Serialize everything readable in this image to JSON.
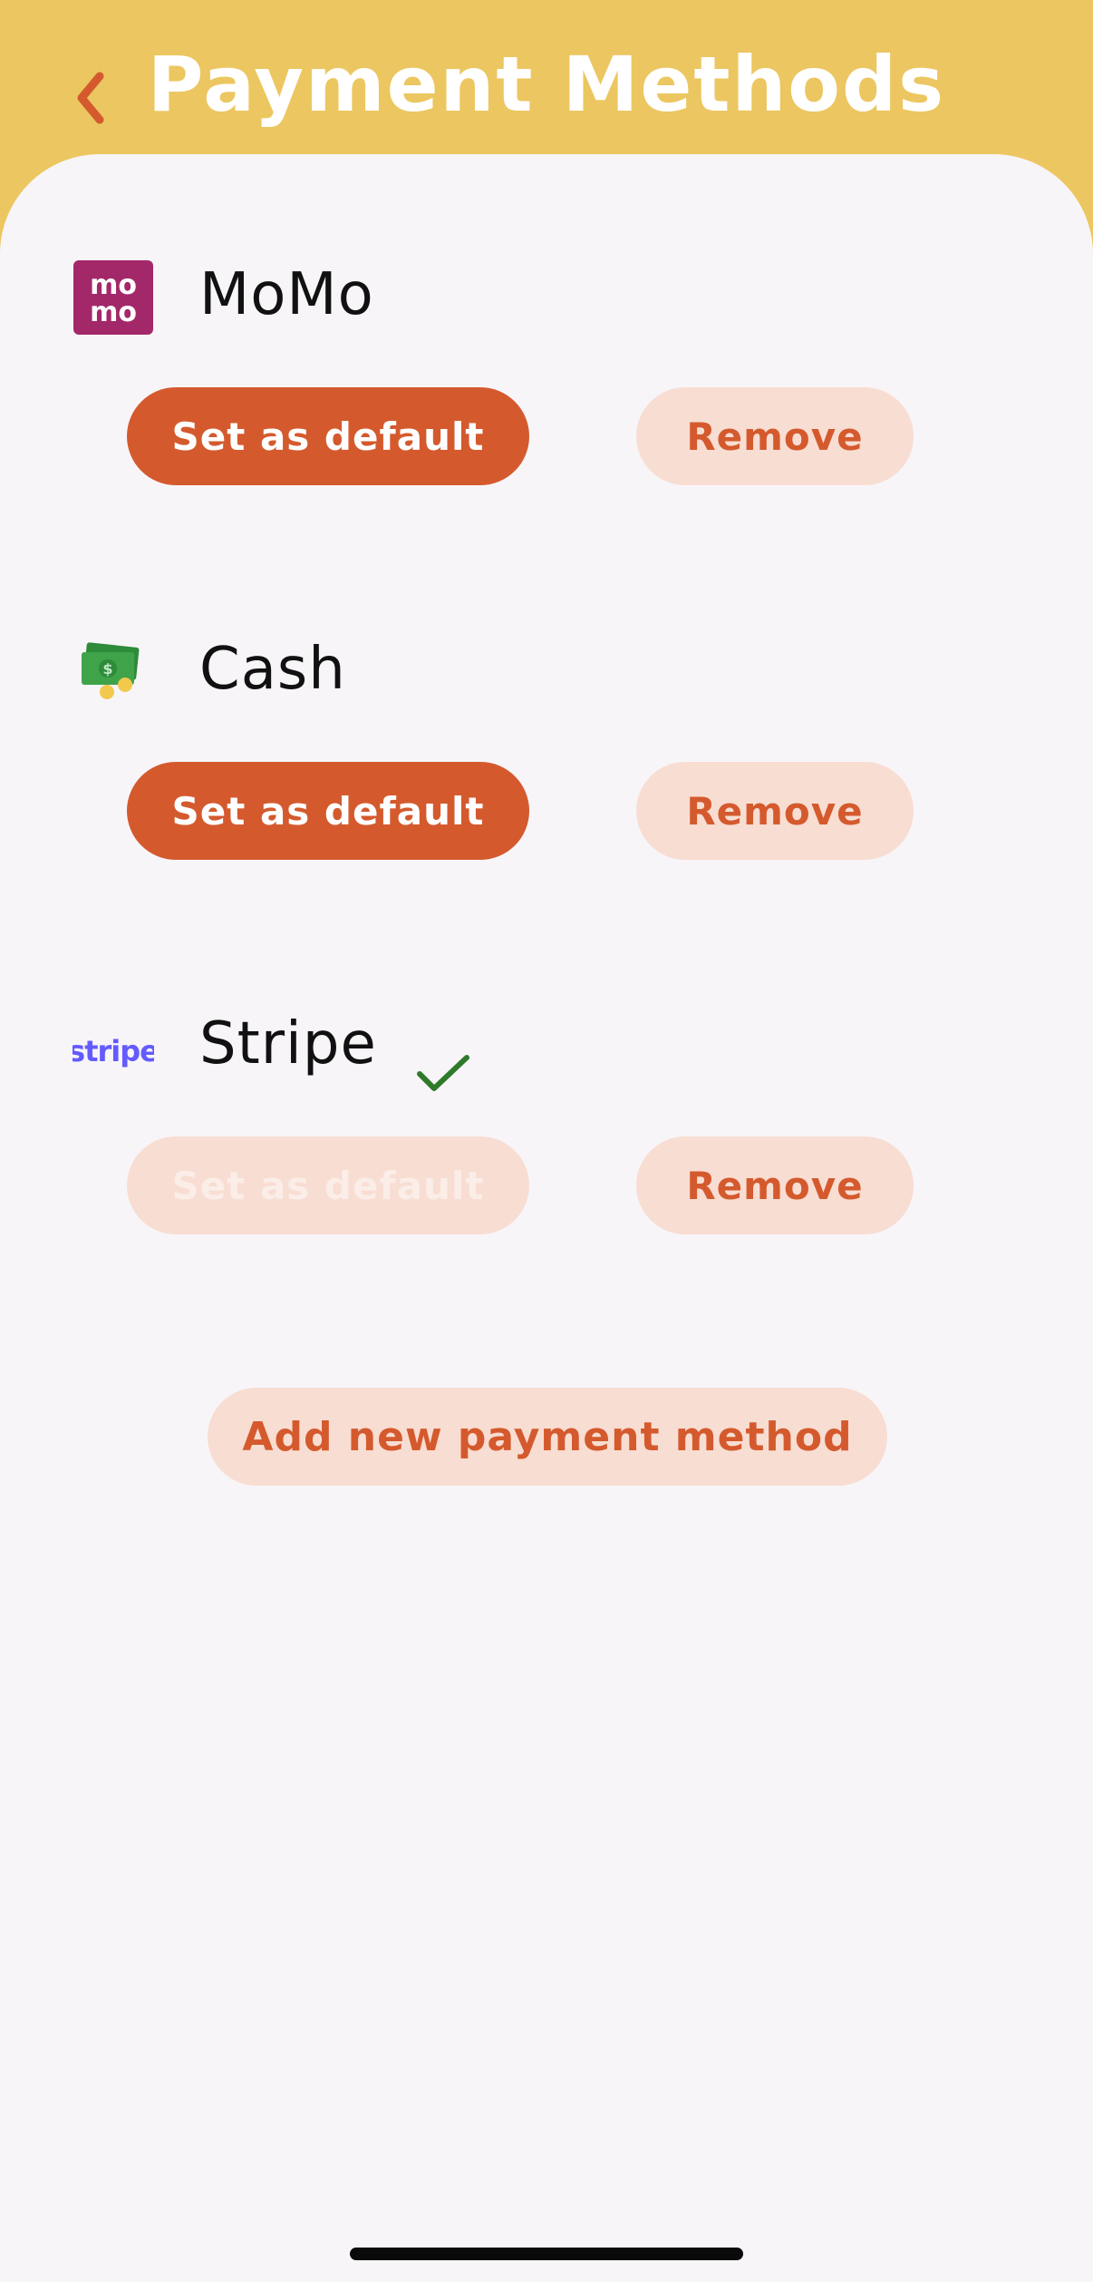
{
  "header": {
    "title": "Payment Methods",
    "back_icon": "chevron-left-icon",
    "background_color": "#ECC660",
    "accent_color": "#D45A2E"
  },
  "methods": [
    {
      "name": "MoMo",
      "logo_text": [
        "mo",
        "mo"
      ],
      "logo_color": "#A3286A",
      "is_default": false,
      "set_default_label": "Set as default",
      "remove_label": "Remove"
    },
    {
      "name": "Cash",
      "logo_icon": "cash-icon",
      "is_default": false,
      "set_default_label": "Set as default",
      "remove_label": "Remove"
    },
    {
      "name": "Stripe",
      "logo_text": "stripe",
      "logo_color": "#635BFF",
      "is_default": true,
      "default_indicator_icon": "check-icon",
      "set_default_label": "Set as default",
      "remove_label": "Remove"
    }
  ],
  "add_method_label": "Add new payment method"
}
